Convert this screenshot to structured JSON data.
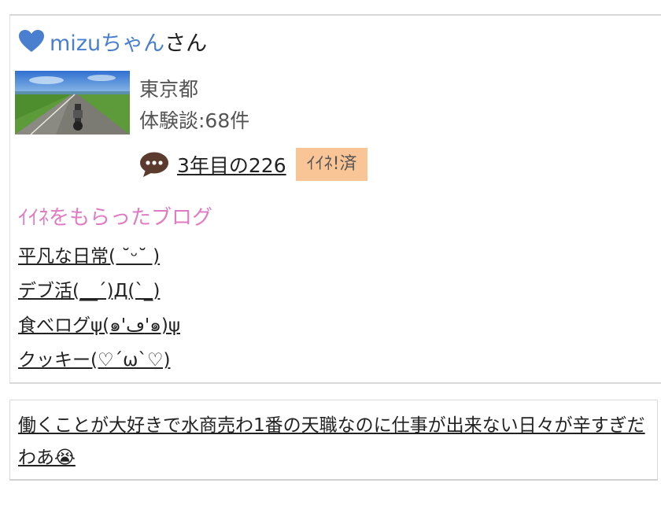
{
  "user": {
    "name": "mizuちゃん",
    "suffix": "さん",
    "location": "東京都",
    "experience_count": "体験談:68件"
  },
  "comment_link": {
    "title": "3年目の226",
    "badge": "ｲｲﾈ!済"
  },
  "liked_blogs": {
    "heading": "ｲｲﾈをもらったブログ",
    "items": [
      "平凡な日常( ˘ᵕ˘ )",
      "デブ活(__´)Д(`_)",
      "食べログψ(๑'ڡ'๑)ψ",
      "クッキー(♡´ω`♡)"
    ]
  },
  "comment": {
    "text": "働くことが大好きで水商売わ1番の天職なのに仕事が出来ない日々が辛すぎだわあ😭"
  },
  "colors": {
    "username": "#4a7fd0",
    "heart": "#4a7fd0",
    "section_title": "#e07bc3",
    "badge_bg": "#f9c596"
  }
}
